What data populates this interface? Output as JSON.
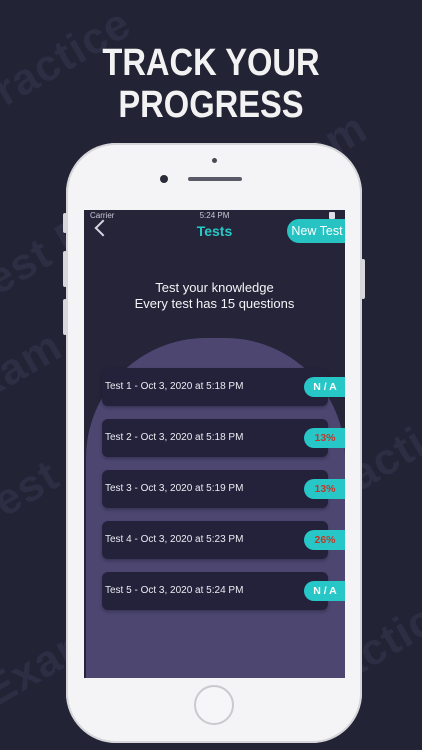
{
  "headline": {
    "line1": "TRACK YOUR",
    "line2": "PROGRESS"
  },
  "background_words": [
    "Practice",
    "Exam",
    "Test Practice",
    "Exam Ba",
    "Practice Exam",
    "Test",
    "Practice Exa",
    "Exam"
  ],
  "status_bar": {
    "carrier": "Carrier",
    "time": "5:24 PM"
  },
  "nav": {
    "title": "Tests",
    "new_test_label": "New Test",
    "back_icon": "chevron-left-icon"
  },
  "intro": {
    "line1": "Test your knowledge",
    "line2": "Every test has 15 questions"
  },
  "tests": [
    {
      "label": "Test 1 - Oct 3, 2020 at 5:18 PM",
      "score": "N / A"
    },
    {
      "label": "Test 2 - Oct 3, 2020 at 5:18 PM",
      "score": "13%"
    },
    {
      "label": "Test 3 - Oct 3, 2020 at 5:19 PM",
      "score": "13%"
    },
    {
      "label": "Test 4 - Oct 3, 2020 at 5:23 PM",
      "score": "26%"
    },
    {
      "label": "Test 5 - Oct 3, 2020 at 5:24 PM",
      "score": "N / A"
    }
  ],
  "colors": {
    "background": "#232336",
    "accent": "#27c7c7",
    "panel": "#4c4671",
    "score_text": "#c0392b"
  }
}
